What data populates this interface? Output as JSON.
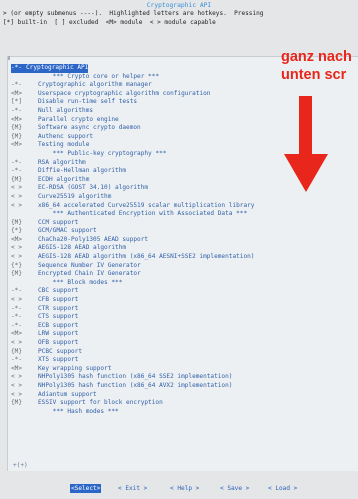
{
  "header": {
    "title": "Cryptographic API",
    "help_line1": "> (or empty submenus ----).  Highlighted letters are hotkeys.  Pressing",
    "help_line2": "[*] built-in  [ ] excluded  <M> module  < > module capable"
  },
  "annotation": {
    "text": "ganz nach\nunten scr",
    "color": "#e8261b"
  },
  "menu": {
    "items": [
      {
        "state": "-*-",
        "label": "Cryptographic API",
        "selected": true
      },
      {
        "state": "",
        "label": "    *** Crypto core or helper ***"
      },
      {
        "state": "-*-",
        "label": "Cryptographic algorithm manager"
      },
      {
        "state": "<M>",
        "label": "Userspace cryptographic algorithm configuration"
      },
      {
        "state": "[*]",
        "label": "Disable run-time self tests"
      },
      {
        "state": "-*-",
        "label": "Null algorithms"
      },
      {
        "state": "<M>",
        "label": "Parallel crypto engine"
      },
      {
        "state": "{M}",
        "label": "Software async crypto daemon"
      },
      {
        "state": "{M}",
        "label": "Authenc support"
      },
      {
        "state": "<M>",
        "label": "Testing module"
      },
      {
        "state": "",
        "label": "    *** Public-key cryptography ***"
      },
      {
        "state": "-*-",
        "label": "RSA algorithm"
      },
      {
        "state": "-*-",
        "label": "Diffie-Hellman algorithm"
      },
      {
        "state": "{M}",
        "label": "ECDH algorithm"
      },
      {
        "state": "< >",
        "label": "EC-RDSA (GOST 34.10) algorithm"
      },
      {
        "state": "< >",
        "label": "Curve25519 algorithm"
      },
      {
        "state": "< >",
        "label": "x86_64 accelerated Curve25519 scalar multiplication library"
      },
      {
        "state": "",
        "label": "    *** Authenticated Encryption with Associated Data ***"
      },
      {
        "state": "{M}",
        "label": "CCM support"
      },
      {
        "state": "{*}",
        "label": "GCM/GMAC support"
      },
      {
        "state": "<M>",
        "label": "ChaCha20-Poly1305 AEAD support"
      },
      {
        "state": "< >",
        "label": "AEGIS-128 AEAD algorithm"
      },
      {
        "state": "< >",
        "label": "AEGIS-128 AEAD algorithm (x86_64 AESNI+SSE2 implementation)"
      },
      {
        "state": "{*}",
        "label": "Sequence Number IV Generator"
      },
      {
        "state": "{M}",
        "label": "Encrypted Chain IV Generator"
      },
      {
        "state": "",
        "label": "    *** Block modes ***"
      },
      {
        "state": "-*-",
        "label": "CBC support"
      },
      {
        "state": "< >",
        "label": "CFB support"
      },
      {
        "state": "-*-",
        "label": "CTR support"
      },
      {
        "state": "-*-",
        "label": "CTS support"
      },
      {
        "state": "-*-",
        "label": "ECB support"
      },
      {
        "state": "<M>",
        "label": "LRW support"
      },
      {
        "state": "< >",
        "label": "OFB support"
      },
      {
        "state": "{M}",
        "label": "PCBC support"
      },
      {
        "state": "-*-",
        "label": "XTS support"
      },
      {
        "state": "<M>",
        "label": "Key wrapping support"
      },
      {
        "state": "< >",
        "label": "NHPoly1305 hash function (x86_64 SSE2 implementation)"
      },
      {
        "state": "< >",
        "label": "NHPoly1305 hash function (x86_64 AVX2 implementation)"
      },
      {
        "state": "< >",
        "label": "Adiantum support"
      },
      {
        "state": "{M}",
        "label": "ESSIV support for block encryption"
      },
      {
        "state": "",
        "label": "    *** Hash modes ***"
      }
    ],
    "more_indicator": "+(+)"
  },
  "buttons": [
    {
      "label": "<Select>",
      "selected": true
    },
    {
      "label": "< Exit >",
      "selected": false
    },
    {
      "label": "< Help >",
      "selected": false
    },
    {
      "label": "< Save >",
      "selected": false
    },
    {
      "label": "< Load >",
      "selected": false
    }
  ]
}
